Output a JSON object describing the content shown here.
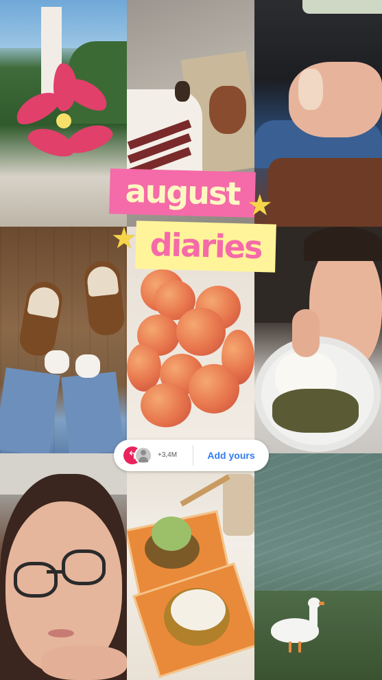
{
  "story": {
    "title_line_1": "august",
    "title_line_2": "diaries",
    "star_glyph": "★",
    "colors": {
      "title_pink": "#f56aa8",
      "title_yellow": "#fff49a",
      "star": "#f6d54a",
      "action_blue": "#2f7cf0",
      "avatar_red": "#e9245c"
    }
  },
  "photos": [
    {
      "name": "pink-lily-photo"
    },
    {
      "name": "legs-and-bag-photo"
    },
    {
      "name": "toy-figure-in-car-photo"
    },
    {
      "name": "slippers-photo"
    },
    {
      "name": "peaches-photo"
    },
    {
      "name": "selfie-with-curry-photo"
    },
    {
      "name": "glasses-selfie-photo"
    },
    {
      "name": "cookies-photo"
    },
    {
      "name": "goose-by-water-photo"
    }
  ],
  "add_yours": {
    "avatar_icon": "↰",
    "count": "+3,4M",
    "action_label": "Add yours"
  }
}
